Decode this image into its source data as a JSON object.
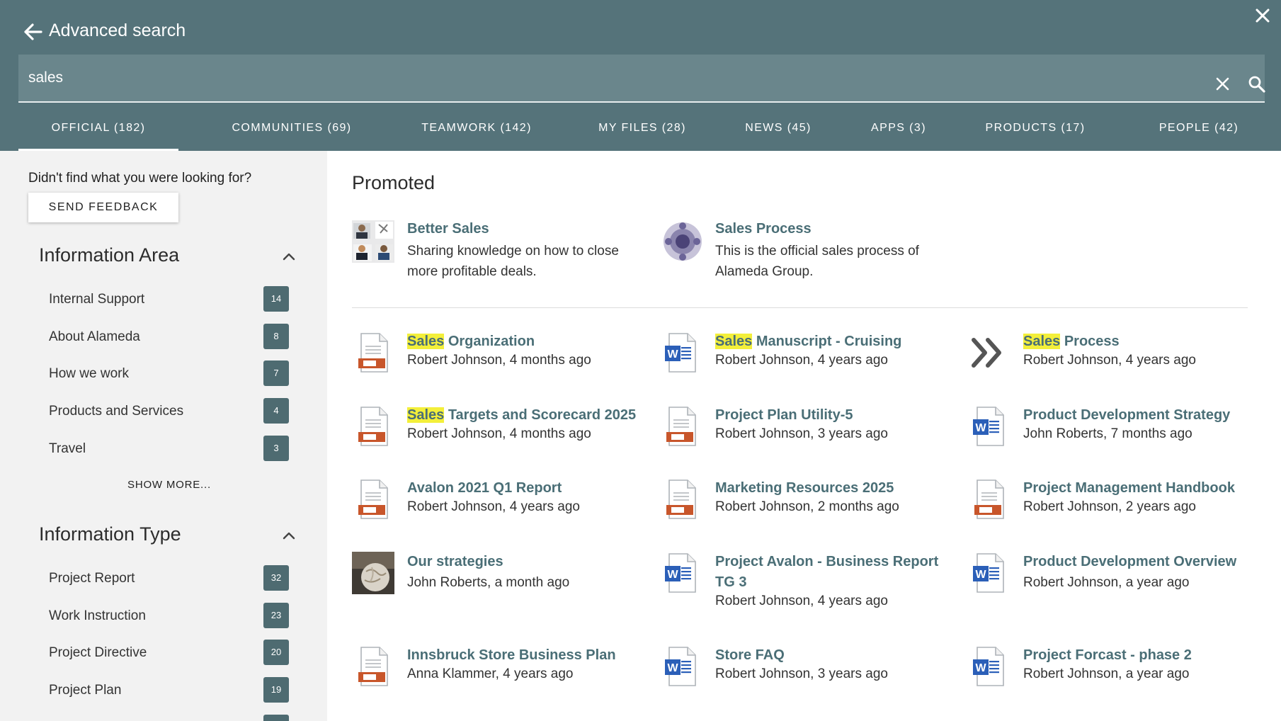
{
  "header": {
    "title": "Advanced search",
    "icons": [
      "back-arrow-icon",
      "close-icon",
      "clear-icon",
      "search-icon"
    ]
  },
  "search": {
    "value": "sales"
  },
  "tabs": [
    {
      "label": "OFFICIAL (182)",
      "active": true
    },
    {
      "label": "COMMUNITIES (69)"
    },
    {
      "label": "TEAMWORK (142)"
    },
    {
      "label": "MY FILES (28)"
    },
    {
      "label": "NEWS (45)"
    },
    {
      "label": "APPS (3)"
    },
    {
      "label": "PRODUCTS (17)"
    },
    {
      "label": "PEOPLE (42)"
    }
  ],
  "sidebar": {
    "feedback_question": "Didn't find what you were looking for?",
    "feedback_button": "SEND FEEDBACK",
    "area_title": "Information Area",
    "area_items": [
      {
        "label": "Internal Support",
        "count": "14"
      },
      {
        "label": "About Alameda",
        "count": "8"
      },
      {
        "label": "How we work",
        "count": "7"
      },
      {
        "label": "Products and Services",
        "count": "4"
      },
      {
        "label": "Travel",
        "count": "3"
      }
    ],
    "show_more": "SHOW MORE...",
    "type_title": "Information Type",
    "type_items": [
      {
        "label": "Project Report",
        "count": "32"
      },
      {
        "label": "Work Instruction",
        "count": "23"
      },
      {
        "label": "Project Directive",
        "count": "20"
      },
      {
        "label": "Project Plan",
        "count": "19"
      }
    ]
  },
  "main": {
    "promoted_title": "Promoted",
    "promoted": [
      {
        "title": "Better Sales",
        "desc": "Sharing knowledge on how to close more profitable deals."
      },
      {
        "title": "Sales Process",
        "desc": "This is the official sales process of Alameda Group."
      }
    ],
    "results": [
      {
        "hl": "Sales",
        "rest": " Organization",
        "meta": "Robert Johnson, 4 months ago",
        "icon": "powerpoint-icon"
      },
      {
        "hl": "Sales",
        "rest": " Manuscript - Cruising",
        "meta": "Robert Johnson, 4 years ago",
        "icon": "word-icon"
      },
      {
        "hl": "Sales",
        "rest": " Process",
        "meta": "Robert Johnson, 4 years ago",
        "icon": "double-chevron-icon"
      },
      {
        "hl": "Sales",
        "rest": " Targets and Scorecard 2025",
        "meta": "Robert Johnson, 4 months ago",
        "icon": "powerpoint-icon"
      },
      {
        "hl": "",
        "rest": "Project Plan Utility-5",
        "meta": "Robert Johnson, 3 years ago",
        "icon": "powerpoint-icon"
      },
      {
        "hl": "",
        "rest": "Product Development Strategy",
        "meta": "John Roberts, 7 months ago",
        "icon": "word-icon"
      },
      {
        "hl": "",
        "rest": "Avalon 2021 Q1 Report",
        "meta": "Robert Johnson, 4 years ago",
        "icon": "powerpoint-icon"
      },
      {
        "hl": "",
        "rest": "Marketing Resources 2025",
        "meta": "Robert Johnson, 2 months ago",
        "icon": "powerpoint-icon"
      },
      {
        "hl": "",
        "rest": "Project Management Handbook",
        "meta": "Robert Johnson, 2 years ago",
        "icon": "powerpoint-icon"
      },
      {
        "hl": "",
        "rest": "Our strategies",
        "meta": "John Roberts, a month ago",
        "icon": "globe-photo-icon"
      },
      {
        "hl": "",
        "rest": "Project Avalon - Business Report TG 3",
        "meta": "Robert Johnson, 4 years ago",
        "icon": "word-icon"
      },
      {
        "hl": "",
        "rest": "Product Development Overview",
        "meta": "Robert Johnson, a year ago",
        "icon": "word-icon"
      },
      {
        "hl": "",
        "rest": "Innsbruck Store Business Plan",
        "meta": "Anna Klammer, 4 years ago",
        "icon": "powerpoint-icon"
      },
      {
        "hl": "",
        "rest": "Store FAQ",
        "meta": "Robert Johnson, 3 years ago",
        "icon": "word-icon"
      },
      {
        "hl": "",
        "rest": "Project Forcast - phase 2",
        "meta": "Robert Johnson, a year ago",
        "icon": "word-icon"
      }
    ]
  },
  "colors": {
    "header_bg": "#55737a",
    "search_bg": "#6a868c",
    "link": "#4a6e76",
    "badge": "#4e6b71",
    "highlight": "#f3ef3a",
    "ppt_orange": "#c8562b",
    "word_blue": "#2b5fb8"
  }
}
